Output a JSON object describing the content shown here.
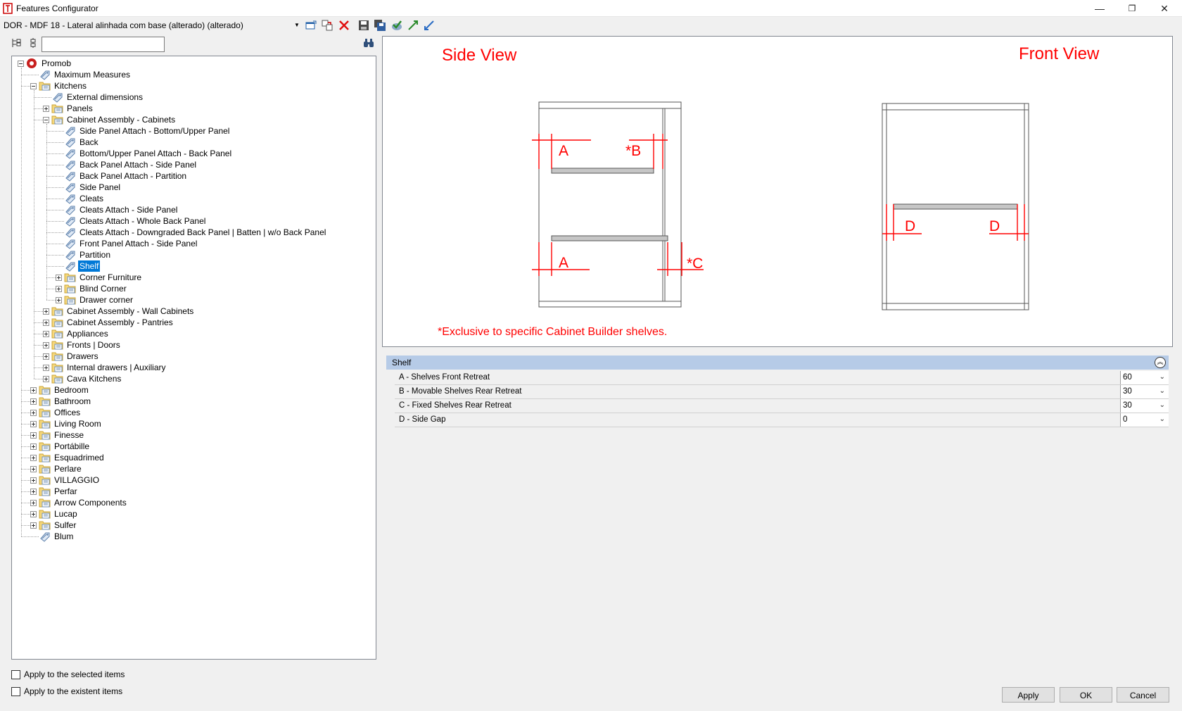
{
  "window": {
    "title": "Features Configurator",
    "minimize_glyph": "—",
    "restore_glyph": "❐",
    "close_glyph": "✕"
  },
  "toolbar": {
    "config_name": "DOR - MDF 18 - Lateral alinhada com base (alterado) (alterado)",
    "icons": [
      "dropdown-arrow-icon",
      "window-icon",
      "copy-icon",
      "delete-icon",
      "save-icon",
      "save-all-icon",
      "check-icon",
      "expand-icon",
      "collapse-icon"
    ]
  },
  "search": {
    "value": "",
    "placeholder": ""
  },
  "tree": {
    "items": [
      {
        "label": "Promob",
        "level": 0,
        "type": "root",
        "expander": "minus"
      },
      {
        "label": "Maximum Measures",
        "level": 1,
        "type": "feature",
        "expander": "none"
      },
      {
        "label": "Kitchens",
        "level": 1,
        "type": "folder",
        "expander": "minus"
      },
      {
        "label": "External dimensions",
        "level": 2,
        "type": "feature",
        "expander": "none"
      },
      {
        "label": "Panels",
        "level": 2,
        "type": "folder",
        "expander": "plus"
      },
      {
        "label": "Cabinet Assembly - Cabinets",
        "level": 2,
        "type": "folder",
        "expander": "minus"
      },
      {
        "label": "Side Panel Attach - Bottom/Upper Panel",
        "level": 3,
        "type": "feature",
        "expander": "none"
      },
      {
        "label": "Back",
        "level": 3,
        "type": "feature",
        "expander": "none"
      },
      {
        "label": "Bottom/Upper Panel Attach - Back Panel",
        "level": 3,
        "type": "feature",
        "expander": "none"
      },
      {
        "label": "Back Panel Attach - Side Panel",
        "level": 3,
        "type": "feature",
        "expander": "none"
      },
      {
        "label": "Back Panel Attach - Partition",
        "level": 3,
        "type": "feature",
        "expander": "none"
      },
      {
        "label": "Side Panel",
        "level": 3,
        "type": "feature",
        "expander": "none"
      },
      {
        "label": "Cleats",
        "level": 3,
        "type": "feature",
        "expander": "none"
      },
      {
        "label": "Cleats Attach - Side Panel",
        "level": 3,
        "type": "feature",
        "expander": "none"
      },
      {
        "label": "Cleats Attach - Whole Back Panel",
        "level": 3,
        "type": "feature",
        "expander": "none"
      },
      {
        "label": "Cleats Attach - Downgraded Back Panel | Batten | w/o Back Panel",
        "level": 3,
        "type": "feature",
        "expander": "none"
      },
      {
        "label": "Front Panel Attach - Side Panel",
        "level": 3,
        "type": "feature",
        "expander": "none"
      },
      {
        "label": "Partition",
        "level": 3,
        "type": "feature",
        "expander": "none"
      },
      {
        "label": "Shelf",
        "level": 3,
        "type": "feature",
        "expander": "none",
        "selected": true
      },
      {
        "label": "Corner Furniture",
        "level": 3,
        "type": "folder",
        "expander": "plus"
      },
      {
        "label": "Blind Corner",
        "level": 3,
        "type": "folder",
        "expander": "plus"
      },
      {
        "label": "Drawer corner",
        "level": 3,
        "type": "folder",
        "expander": "plus"
      },
      {
        "label": "Cabinet Assembly - Wall Cabinets",
        "level": 2,
        "type": "folder",
        "expander": "plus"
      },
      {
        "label": "Cabinet Assembly - Pantries",
        "level": 2,
        "type": "folder",
        "expander": "plus"
      },
      {
        "label": "Appliances",
        "level": 2,
        "type": "folder",
        "expander": "plus"
      },
      {
        "label": "Fronts | Doors",
        "level": 2,
        "type": "folder",
        "expander": "plus"
      },
      {
        "label": "Drawers",
        "level": 2,
        "type": "folder",
        "expander": "plus"
      },
      {
        "label": "Internal drawers | Auxiliary",
        "level": 2,
        "type": "folder",
        "expander": "plus"
      },
      {
        "label": "Cava Kitchens",
        "level": 2,
        "type": "folder",
        "expander": "plus"
      },
      {
        "label": "Bedroom",
        "level": 1,
        "type": "folder",
        "expander": "plus"
      },
      {
        "label": "Bathroom",
        "level": 1,
        "type": "folder",
        "expander": "plus"
      },
      {
        "label": "Offices",
        "level": 1,
        "type": "folder",
        "expander": "plus"
      },
      {
        "label": "Living Room",
        "level": 1,
        "type": "folder",
        "expander": "plus"
      },
      {
        "label": "Finesse",
        "level": 1,
        "type": "folder",
        "expander": "plus"
      },
      {
        "label": "Portábille",
        "level": 1,
        "type": "folder",
        "expander": "plus"
      },
      {
        "label": "Esquadrimed",
        "level": 1,
        "type": "folder",
        "expander": "plus"
      },
      {
        "label": "Perlare",
        "level": 1,
        "type": "folder",
        "expander": "plus"
      },
      {
        "label": "VILLAGGIO",
        "level": 1,
        "type": "folder",
        "expander": "plus"
      },
      {
        "label": "Perfar",
        "level": 1,
        "type": "folder",
        "expander": "plus"
      },
      {
        "label": "Arrow Components",
        "level": 1,
        "type": "folder",
        "expander": "plus"
      },
      {
        "label": "Lucap",
        "level": 1,
        "type": "folder",
        "expander": "plus"
      },
      {
        "label": "Sulfer",
        "level": 1,
        "type": "folder",
        "expander": "plus"
      },
      {
        "label": "Blum",
        "level": 1,
        "type": "feature",
        "expander": "none"
      }
    ]
  },
  "options": {
    "apply_selected": "Apply to the selected items",
    "apply_existent": "Apply to the existent items"
  },
  "preview": {
    "side_view_title": "Side View",
    "front_view_title": "Front View",
    "note": "*Exclusive to specific Cabinet Builder shelves.",
    "label_a": "A",
    "label_b": "*B",
    "label_c": "*C",
    "label_d": "D",
    "accent_color": "#ff0000"
  },
  "properties": {
    "group_title": "Shelf",
    "rows": [
      {
        "name": "A - Shelves Front Retreat",
        "value": "60"
      },
      {
        "name": "B - Movable Shelves Rear Retreat",
        "value": "30"
      },
      {
        "name": "C - Fixed Shelves Rear Retreat",
        "value": "30"
      },
      {
        "name": "D - Side Gap",
        "value": "0"
      }
    ]
  },
  "buttons": {
    "apply": "Apply",
    "ok": "OK",
    "cancel": "Cancel"
  }
}
